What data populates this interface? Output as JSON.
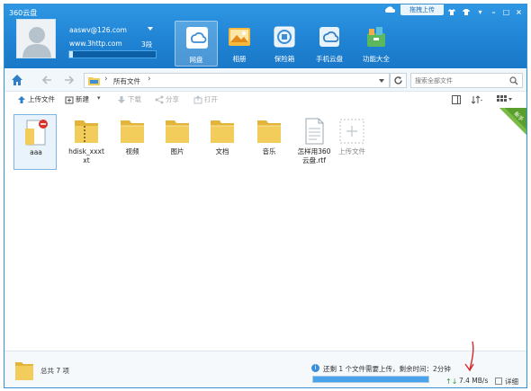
{
  "app": {
    "title": "360云盘"
  },
  "account": {
    "email": "aaswv@126.com",
    "site": "www.3http.com",
    "quota_text": "3段",
    "quota_fraction": 0.04
  },
  "nav": [
    {
      "label": "网盘",
      "active": true,
      "icon": "cloud-drive-icon"
    },
    {
      "label": "相册",
      "active": false,
      "icon": "photo-album-icon"
    },
    {
      "label": "保险箱",
      "active": false,
      "icon": "safe-box-icon"
    },
    {
      "label": "手机云盘",
      "active": false,
      "icon": "mobile-cloud-icon"
    },
    {
      "label": "功能大全",
      "active": false,
      "icon": "toolbox-icon"
    }
  ],
  "titlebar": {
    "upload_tab": "拖拽上传"
  },
  "address": {
    "path": "所有文件",
    "search_placeholder": "搜索全部文件"
  },
  "toolbar": {
    "upload": "上传文件",
    "new": "新建",
    "download": "下载",
    "share": "分享",
    "open": "打开"
  },
  "corner_badge": "新手",
  "files": [
    {
      "name": "aaa",
      "type": "doc",
      "selected": true
    },
    {
      "name": "hdisk_xxxt\nxt",
      "type": "zip-folder",
      "selected": false
    },
    {
      "name": "视频",
      "type": "folder",
      "selected": false
    },
    {
      "name": "图片",
      "type": "folder",
      "selected": false
    },
    {
      "name": "文档",
      "type": "folder",
      "selected": false
    },
    {
      "name": "音乐",
      "type": "folder",
      "selected": false
    },
    {
      "name": "怎样用360\n云盘.rtf",
      "type": "rtf",
      "selected": false
    },
    {
      "name": "上传文件",
      "type": "upload-placeholder",
      "selected": false
    }
  ],
  "status": {
    "total": "总共 7 项",
    "upload_msg": "还剩 1 个文件需要上传，剩余时间：2分钟",
    "upload_progress": 1.0,
    "speed": "7.4 MB/s",
    "detail": "详细"
  },
  "colors": {
    "header": "#1f82d2",
    "accent": "#3b8ed8",
    "folder": "#f3cd5c",
    "annotation": "#d6292a"
  }
}
